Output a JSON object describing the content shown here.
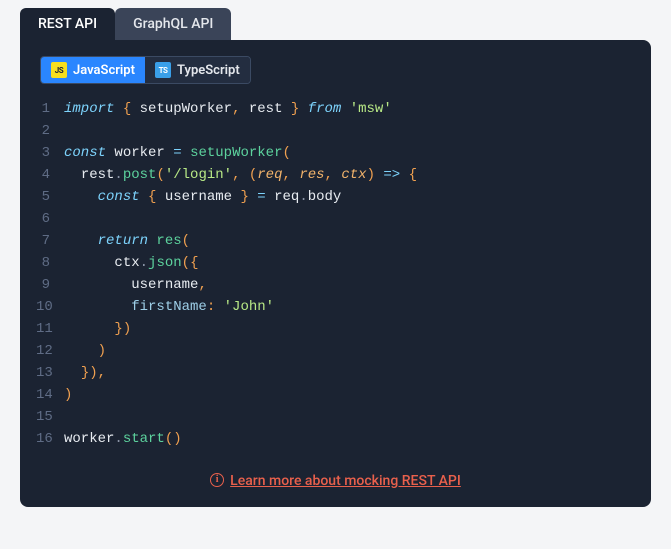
{
  "tabs": {
    "rest": {
      "label": "REST API"
    },
    "graphql": {
      "label": "GraphQL API"
    }
  },
  "langs": {
    "js": {
      "badge": "JS",
      "label": "JavaScript"
    },
    "ts": {
      "badge": "TS",
      "label": "TypeScript"
    }
  },
  "code": {
    "line_count": 16,
    "l1": {
      "import": "import",
      "ob": "{ ",
      "setupWorker": "setupWorker",
      "c1": ", ",
      "rest": "rest",
      "cb": " }",
      "from": " from ",
      "msw": "'msw'"
    },
    "l3": {
      "const": "const ",
      "worker": "worker",
      "eq": " = ",
      "setupWorker": "setupWorker",
      "op": "("
    },
    "l4": {
      "ind": "  ",
      "rest": "rest",
      "dot": ".",
      "post": "post",
      "op": "(",
      "url": "'/login'",
      "c": ", ",
      "po": "(",
      "req": "req",
      "c1": ", ",
      "res": "res",
      "c2": ", ",
      "ctx": "ctx",
      "pc": ")",
      "arrow": " => ",
      "ob": "{"
    },
    "l5": {
      "ind": "    ",
      "const": "const ",
      "ob": "{ ",
      "username": "username",
      "cb": " }",
      "eq": " = ",
      "req": "req",
      "dot": ".",
      "body": "body"
    },
    "l7": {
      "ind": "    ",
      "return": "return ",
      "res": "res",
      "op": "("
    },
    "l8": {
      "ind": "      ",
      "ctx": "ctx",
      "dot": ".",
      "json": "json",
      "op": "(",
      "ob": "{"
    },
    "l9": {
      "ind": "        ",
      "username": "username",
      "c": ","
    },
    "l10": {
      "ind": "        ",
      "firstName": "firstName",
      "col": ": ",
      "val": "'John'"
    },
    "l11": {
      "ind": "      ",
      "cb": "}",
      ")": ")"
    },
    "l12": {
      "ind": "    ",
      ")": ")"
    },
    "l13": {
      "ind": "  ",
      "cb": "}",
      ")": ")",
      "c": ","
    },
    "l14": {
      ")": ")"
    },
    "l16": {
      "worker": "worker",
      "dot": ".",
      "start": "start",
      "op": "(",
      ")": ")"
    }
  },
  "footer": {
    "link_text": "Learn more about mocking REST API"
  }
}
